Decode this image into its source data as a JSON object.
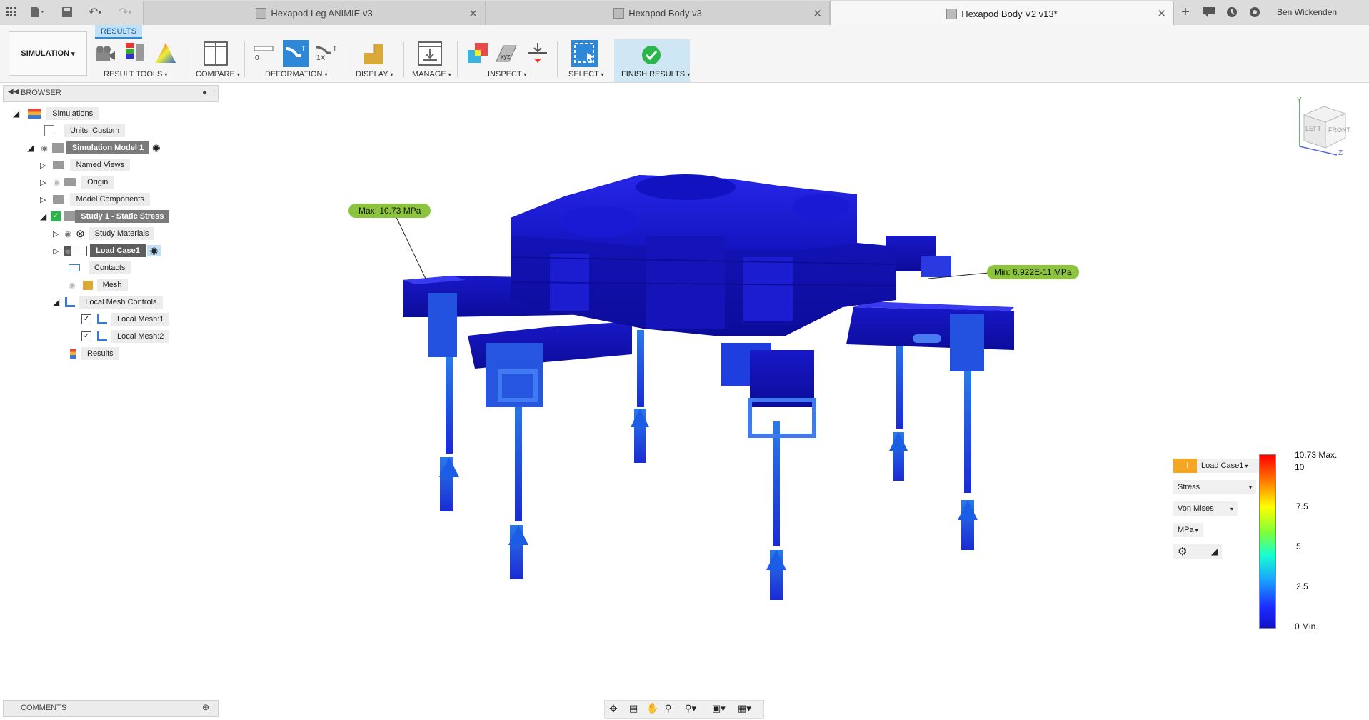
{
  "tabs": [
    {
      "label": "Hexapod Leg ANIMIE v3",
      "active": false
    },
    {
      "label": "Hexapod Body v3",
      "active": false
    },
    {
      "label": "Hexapod Body V2 v13*",
      "active": true
    }
  ],
  "user": {
    "name": "Ben Wickenden"
  },
  "ribbon": {
    "workspace": "SIMULATION",
    "results_tab": "RESULTS",
    "groups": {
      "result_tools": "RESULT TOOLS",
      "compare": "COMPARE",
      "deformation": "DEFORMATION",
      "display": "DISPLAY",
      "manage": "MANAGE",
      "inspect": "INSPECT",
      "select": "SELECT",
      "finish_results": "FINISH RESULTS"
    },
    "deformation_scale": {
      "zero": "0",
      "one": "1X"
    }
  },
  "browser": {
    "title": "BROWSER",
    "items": [
      {
        "label": "Simulations"
      },
      {
        "label": "Units: Custom"
      },
      {
        "label": "Simulation Model 1"
      },
      {
        "label": "Named Views"
      },
      {
        "label": "Origin"
      },
      {
        "label": "Model Components"
      },
      {
        "label": "Study 1 - Static Stress"
      },
      {
        "label": "Study Materials"
      },
      {
        "label": "Load Case1"
      },
      {
        "label": "Contacts"
      },
      {
        "label": "Mesh"
      },
      {
        "label": "Local Mesh Controls"
      },
      {
        "label": "Local Mesh:1"
      },
      {
        "label": "Local Mesh:2"
      },
      {
        "label": "Results"
      }
    ]
  },
  "probes": {
    "max": "Max: 10.73 MPa",
    "min": "Min: 6.922E-11 MPa"
  },
  "viewcube": {
    "left": "LEFT",
    "front": "FRONT",
    "y": "Y",
    "z": "Z"
  },
  "legend": {
    "load_case": "Load Case1",
    "result_type": "Stress",
    "component": "Von Mises",
    "units": "MPa",
    "max_label": "10.73 Max.",
    "ticks": [
      "10",
      "7.5",
      "5",
      "2.5",
      "0 Min."
    ]
  },
  "comments": {
    "title": "COMMENTS"
  },
  "colors": {
    "stress_low": "#1515d0",
    "stress_mid": "#22c8ff",
    "stress_high": "#e21010",
    "probe_green": "#8cc43d"
  }
}
